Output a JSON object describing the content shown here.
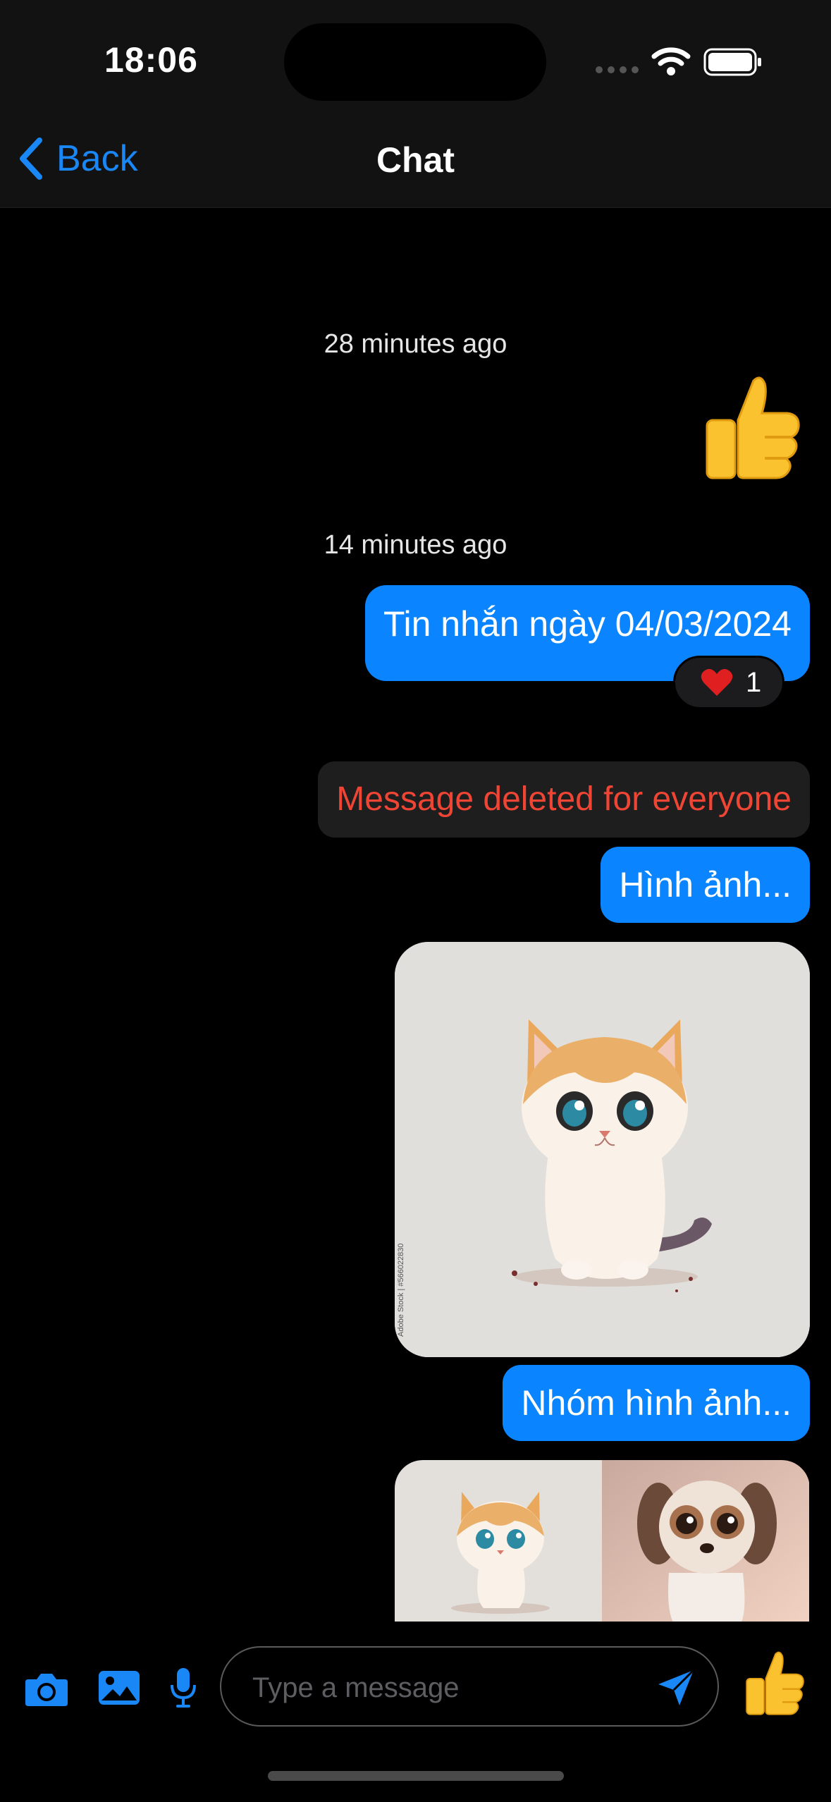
{
  "status_bar": {
    "time": "18:06"
  },
  "nav": {
    "back_label": "Back",
    "title": "Chat"
  },
  "messages": [
    {
      "timestamp": "28 minutes ago",
      "type": "emoji",
      "emoji": "thumbs-up"
    },
    {
      "timestamp": "14 minutes ago",
      "type": "text",
      "text": "Tin nhắn ngày 04/03/2024",
      "reaction": {
        "emoji": "heart",
        "count": "1"
      }
    },
    {
      "type": "deleted",
      "text": "Message deleted for everyone"
    },
    {
      "type": "text",
      "text": "Hình ảnh..."
    },
    {
      "type": "image",
      "subject": "cartoon cat"
    },
    {
      "type": "text",
      "text": "Nhóm hình ảnh..."
    },
    {
      "type": "image-group",
      "subjects": [
        "cartoon cat",
        "cartoon puppy"
      ]
    }
  ],
  "input": {
    "placeholder": "Type a message"
  },
  "colors": {
    "accent": "#0a84ff",
    "deleted_text": "#ef4535",
    "bar_bg": "#121212"
  }
}
